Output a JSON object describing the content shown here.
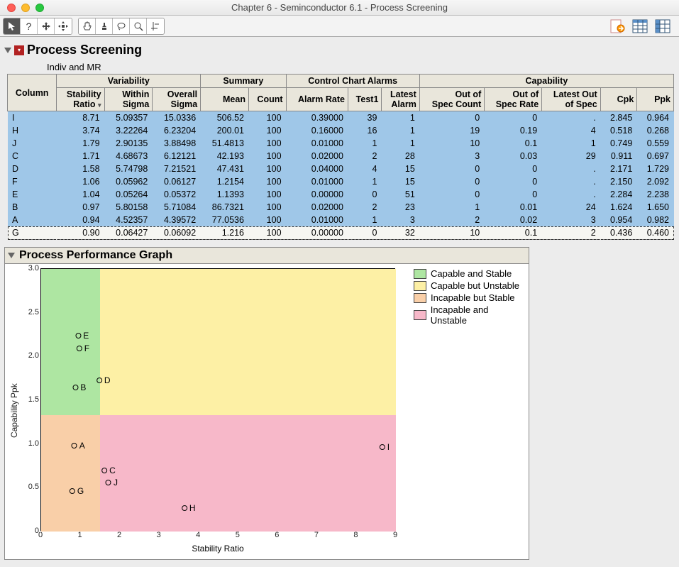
{
  "window": {
    "title": "Chapter 6 - Seminconductor 6.1 - Process Screening"
  },
  "section": {
    "title": "Process Screening",
    "subtitle": "Indiv and MR",
    "graph_title": "Process Performance Graph"
  },
  "headers": {
    "column": "Column",
    "grp_variability": "Variability",
    "grp_summary": "Summary",
    "grp_alarms": "Control Chart Alarms",
    "grp_capability": "Capability",
    "stability_ratio": "Stability\nRatio",
    "within_sigma": "Within\nSigma",
    "overall_sigma": "Overall\nSigma",
    "mean": "Mean",
    "count": "Count",
    "alarm_rate": "Alarm Rate",
    "test1": "Test1",
    "latest_alarm": "Latest\nAlarm",
    "out_spec_count": "Out of\nSpec Count",
    "out_spec_rate": "Out of\nSpec Rate",
    "latest_out_spec": "Latest Out\nof Spec",
    "cpk": "Cpk",
    "ppk": "Ppk"
  },
  "rows": [
    {
      "col": "I",
      "sr": "8.71",
      "ws": "5.09357",
      "os": "15.0336",
      "mean": "506.52",
      "count": "100",
      "ar": "0.39000",
      "t1": "39",
      "la": "1",
      "osc": "0",
      "osr": "0",
      "los": ".",
      "cpk": "2.845",
      "ppk": "0.964",
      "sel": true
    },
    {
      "col": "H",
      "sr": "3.74",
      "ws": "3.22264",
      "os": "6.23204",
      "mean": "200.01",
      "count": "100",
      "ar": "0.16000",
      "t1": "16",
      "la": "1",
      "osc": "19",
      "osr": "0.19",
      "los": "4",
      "cpk": "0.518",
      "ppk": "0.268",
      "sel": true
    },
    {
      "col": "J",
      "sr": "1.79",
      "ws": "2.90135",
      "os": "3.88498",
      "mean": "51.4813",
      "count": "100",
      "ar": "0.01000",
      "t1": "1",
      "la": "1",
      "osc": "10",
      "osr": "0.1",
      "los": "1",
      "cpk": "0.749",
      "ppk": "0.559",
      "sel": true
    },
    {
      "col": "C",
      "sr": "1.71",
      "ws": "4.68673",
      "os": "6.12121",
      "mean": "42.193",
      "count": "100",
      "ar": "0.02000",
      "t1": "2",
      "la": "28",
      "osc": "3",
      "osr": "0.03",
      "los": "29",
      "cpk": "0.911",
      "ppk": "0.697",
      "sel": true
    },
    {
      "col": "D",
      "sr": "1.58",
      "ws": "5.74798",
      "os": "7.21521",
      "mean": "47.431",
      "count": "100",
      "ar": "0.04000",
      "t1": "4",
      "la": "15",
      "osc": "0",
      "osr": "0",
      "los": ".",
      "cpk": "2.171",
      "ppk": "1.729",
      "sel": true
    },
    {
      "col": "F",
      "sr": "1.06",
      "ws": "0.05962",
      "os": "0.06127",
      "mean": "1.2154",
      "count": "100",
      "ar": "0.01000",
      "t1": "1",
      "la": "15",
      "osc": "0",
      "osr": "0",
      "los": ".",
      "cpk": "2.150",
      "ppk": "2.092",
      "sel": true
    },
    {
      "col": "E",
      "sr": "1.04",
      "ws": "0.05264",
      "os": "0.05372",
      "mean": "1.1393",
      "count": "100",
      "ar": "0.00000",
      "t1": "0",
      "la": "51",
      "osc": "0",
      "osr": "0",
      "los": ".",
      "cpk": "2.284",
      "ppk": "2.238",
      "sel": true
    },
    {
      "col": "B",
      "sr": "0.97",
      "ws": "5.80158",
      "os": "5.71084",
      "mean": "86.7321",
      "count": "100",
      "ar": "0.02000",
      "t1": "2",
      "la": "23",
      "osc": "1",
      "osr": "0.01",
      "los": "24",
      "cpk": "1.624",
      "ppk": "1.650",
      "sel": true
    },
    {
      "col": "A",
      "sr": "0.94",
      "ws": "4.52357",
      "os": "4.39572",
      "mean": "77.0536",
      "count": "100",
      "ar": "0.01000",
      "t1": "1",
      "la": "3",
      "osc": "2",
      "osr": "0.02",
      "los": "3",
      "cpk": "0.954",
      "ppk": "0.982",
      "sel": true
    },
    {
      "col": "G",
      "sr": "0.90",
      "ws": "0.06427",
      "os": "0.06092",
      "mean": "1.216",
      "count": "100",
      "ar": "0.00000",
      "t1": "0",
      "la": "32",
      "osc": "10",
      "osr": "0.1",
      "los": "2",
      "cpk": "0.436",
      "ppk": "0.460",
      "sel": false
    }
  ],
  "legend": {
    "cs": "Capable and Stable",
    "cu": "Capable but Unstable",
    "is": "Incapable but Stable",
    "iu": "Incapable and Unstable"
  },
  "colors": {
    "cs": "#aee6a2",
    "cu": "#fdf0a5",
    "is": "#f9cfa8",
    "iu": "#f7b8c9"
  },
  "chart_data": {
    "type": "scatter",
    "xlabel": "Stability Ratio",
    "ylabel": "Capability Ppk",
    "xlim": [
      0,
      9
    ],
    "ylim": [
      0,
      3.0
    ],
    "xticks": [
      0,
      1,
      2,
      3,
      4,
      5,
      6,
      7,
      8,
      9
    ],
    "yticks": [
      0,
      0.5,
      1.0,
      1.5,
      2.0,
      2.5,
      3.0
    ],
    "region_split": {
      "x": 1.5,
      "y": 1.33
    },
    "points": [
      {
        "label": "I",
        "x": 8.71,
        "y": 0.964
      },
      {
        "label": "H",
        "x": 3.74,
        "y": 0.268
      },
      {
        "label": "J",
        "x": 1.79,
        "y": 0.559
      },
      {
        "label": "C",
        "x": 1.71,
        "y": 0.697
      },
      {
        "label": "D",
        "x": 1.58,
        "y": 1.729
      },
      {
        "label": "F",
        "x": 1.06,
        "y": 2.092
      },
      {
        "label": "E",
        "x": 1.04,
        "y": 2.238
      },
      {
        "label": "B",
        "x": 0.97,
        "y": 1.65
      },
      {
        "label": "A",
        "x": 0.94,
        "y": 0.982
      },
      {
        "label": "G",
        "x": 0.9,
        "y": 0.46
      }
    ]
  }
}
